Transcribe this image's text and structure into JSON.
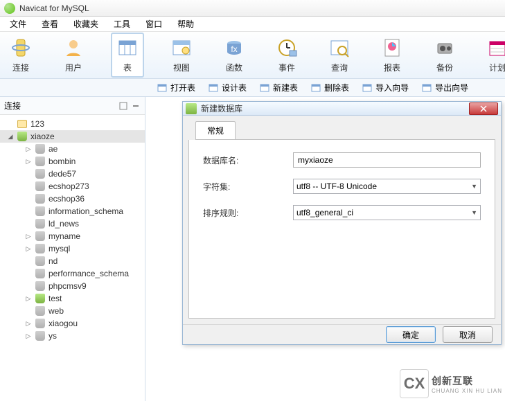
{
  "app": {
    "title": "Navicat for MySQL"
  },
  "menus": [
    "文件",
    "查看",
    "收藏夹",
    "工具",
    "窗口",
    "帮助"
  ],
  "toolbar": [
    {
      "key": "connect",
      "label": "连接"
    },
    {
      "key": "user",
      "label": "用户"
    },
    {
      "key": "table",
      "label": "表",
      "active": true
    },
    {
      "key": "view",
      "label": "视图"
    },
    {
      "key": "func",
      "label": "函数"
    },
    {
      "key": "event",
      "label": "事件"
    },
    {
      "key": "query",
      "label": "查询"
    },
    {
      "key": "report",
      "label": "报表"
    },
    {
      "key": "backup",
      "label": "备份"
    },
    {
      "key": "plan",
      "label": "计划"
    }
  ],
  "subtoolbar": [
    {
      "key": "open",
      "label": "打开表"
    },
    {
      "key": "design",
      "label": "设计表"
    },
    {
      "key": "new",
      "label": "新建表"
    },
    {
      "key": "delete",
      "label": "删除表"
    },
    {
      "key": "import",
      "label": "导入向导"
    },
    {
      "key": "export",
      "label": "导出向导"
    }
  ],
  "sidebar": {
    "header": "连接",
    "tree": [
      {
        "label": "123",
        "depth": 0,
        "icon": "folder"
      },
      {
        "label": "xiaoze",
        "depth": 0,
        "icon": "db-open",
        "expanded": true,
        "selected": true
      },
      {
        "label": "ae",
        "depth": 2,
        "icon": "db",
        "expandable": true
      },
      {
        "label": "bombin",
        "depth": 2,
        "icon": "db",
        "expandable": true
      },
      {
        "label": "dede57",
        "depth": 2,
        "icon": "db"
      },
      {
        "label": "ecshop273",
        "depth": 2,
        "icon": "db"
      },
      {
        "label": "ecshop36",
        "depth": 2,
        "icon": "db"
      },
      {
        "label": "information_schema",
        "depth": 2,
        "icon": "db"
      },
      {
        "label": "ld_news",
        "depth": 2,
        "icon": "db"
      },
      {
        "label": "myname",
        "depth": 2,
        "icon": "db",
        "expandable": true
      },
      {
        "label": "mysql",
        "depth": 2,
        "icon": "db",
        "expandable": true
      },
      {
        "label": "nd",
        "depth": 2,
        "icon": "db"
      },
      {
        "label": "performance_schema",
        "depth": 2,
        "icon": "db"
      },
      {
        "label": "phpcmsv9",
        "depth": 2,
        "icon": "db"
      },
      {
        "label": "test",
        "depth": 2,
        "icon": "db-open",
        "expandable": true
      },
      {
        "label": "web",
        "depth": 2,
        "icon": "db"
      },
      {
        "label": "xiaogou",
        "depth": 2,
        "icon": "db",
        "expandable": true
      },
      {
        "label": "ys",
        "depth": 2,
        "icon": "db",
        "expandable": true
      }
    ]
  },
  "dialog": {
    "title": "新建数据库",
    "tab": "常规",
    "fields": {
      "name_label": "数据库名:",
      "name_value": "myxiaoze",
      "charset_label": "字符集:",
      "charset_value": "utf8 -- UTF-8 Unicode",
      "collation_label": "排序规则:",
      "collation_value": "utf8_general_ci"
    },
    "buttons": {
      "ok": "确定",
      "cancel": "取消"
    }
  },
  "watermark": {
    "brand": "创新互联",
    "sub": "CHUANG XIN HU LIAN",
    "logo": "CX"
  }
}
